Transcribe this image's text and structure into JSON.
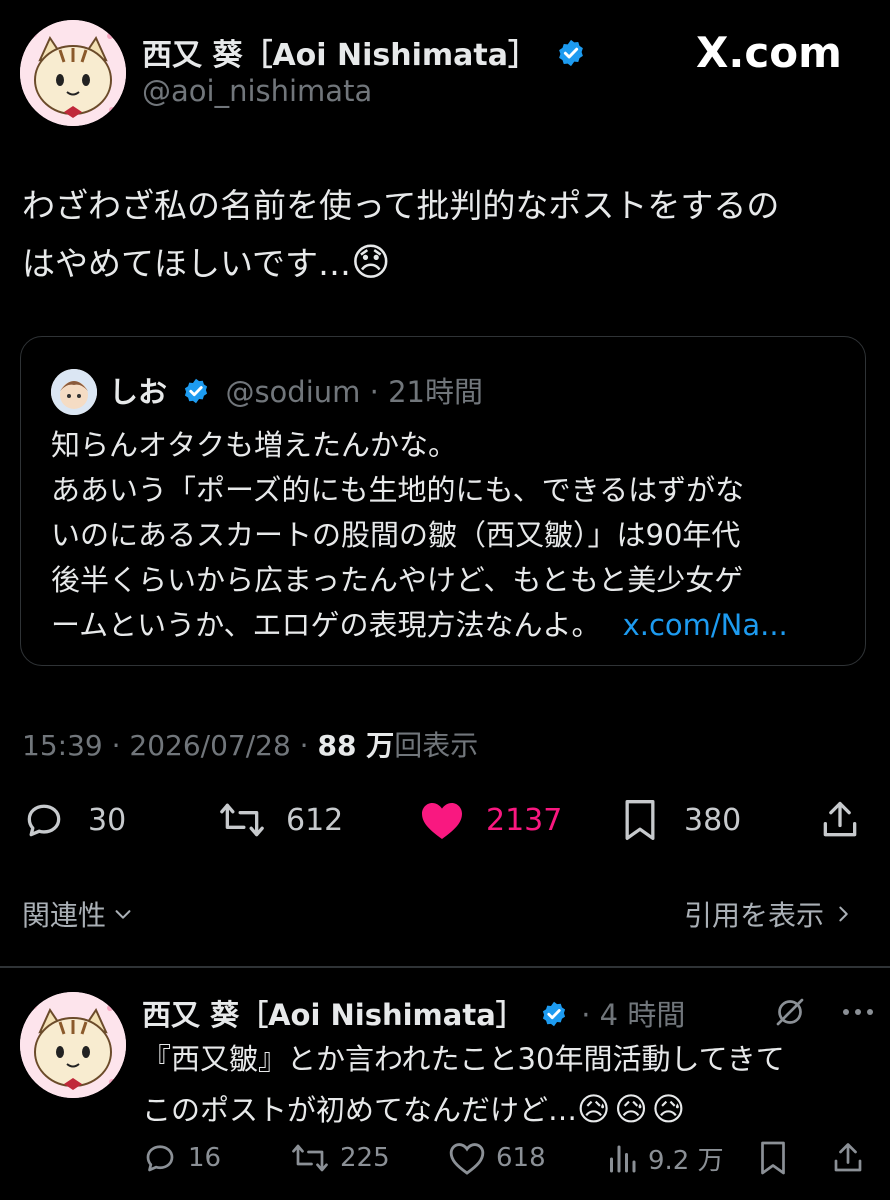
{
  "brand": {
    "logo_text": "X.com"
  },
  "post": {
    "author_name": "西又 葵［Aoi Nishimata］",
    "author_handle": "@aoi_nishimata",
    "text_line1": "わざわざ私の名前を使って批判的なポストをするの",
    "text_line2": "はやめてほしいです…",
    "emoji": "😞",
    "quote": {
      "author_name": "しお",
      "author_handle": "@sodium",
      "time": "21時間",
      "lines": [
        "知らんオタクも増えたんかな。",
        "ああいう「ポーズ的にも生地的にも、できるはずがな",
        "いのにあるスカートの股間の皺（西又皺）」は90年代",
        "後半くらいから広まったんやけど、もともと美少女ゲ",
        "ームというか、エロゲの表現方法なんよ。"
      ],
      "link_text": "x.com/Na..."
    },
    "timestamp": "15:39 · 2026/07/28 · ",
    "views_count": "88 万",
    "views_label": "回表示",
    "stats": {
      "replies": "30",
      "reposts": "612",
      "likes": "2137",
      "bookmarks": "380"
    }
  },
  "related": {
    "label": "関連性",
    "quote_view_label": "引用を表示"
  },
  "reply": {
    "author_name": "西又 葵［Aoi Nishimata］",
    "time": "· 4 時間",
    "text_line1": "『西又皺』とか言われたこと30年間活動してきて",
    "text_line2": "このポストが初めてなんだけど…",
    "emojis": "😥😥😥",
    "stats": {
      "replies": "16",
      "reposts": "225",
      "likes": "618",
      "views": "9.2 万"
    }
  },
  "colors": {
    "background": "#000000",
    "text": "#e7e9ea",
    "muted": "#71767b",
    "link": "#1d9bf0",
    "like": "#f91880",
    "border": "#2f3336"
  }
}
